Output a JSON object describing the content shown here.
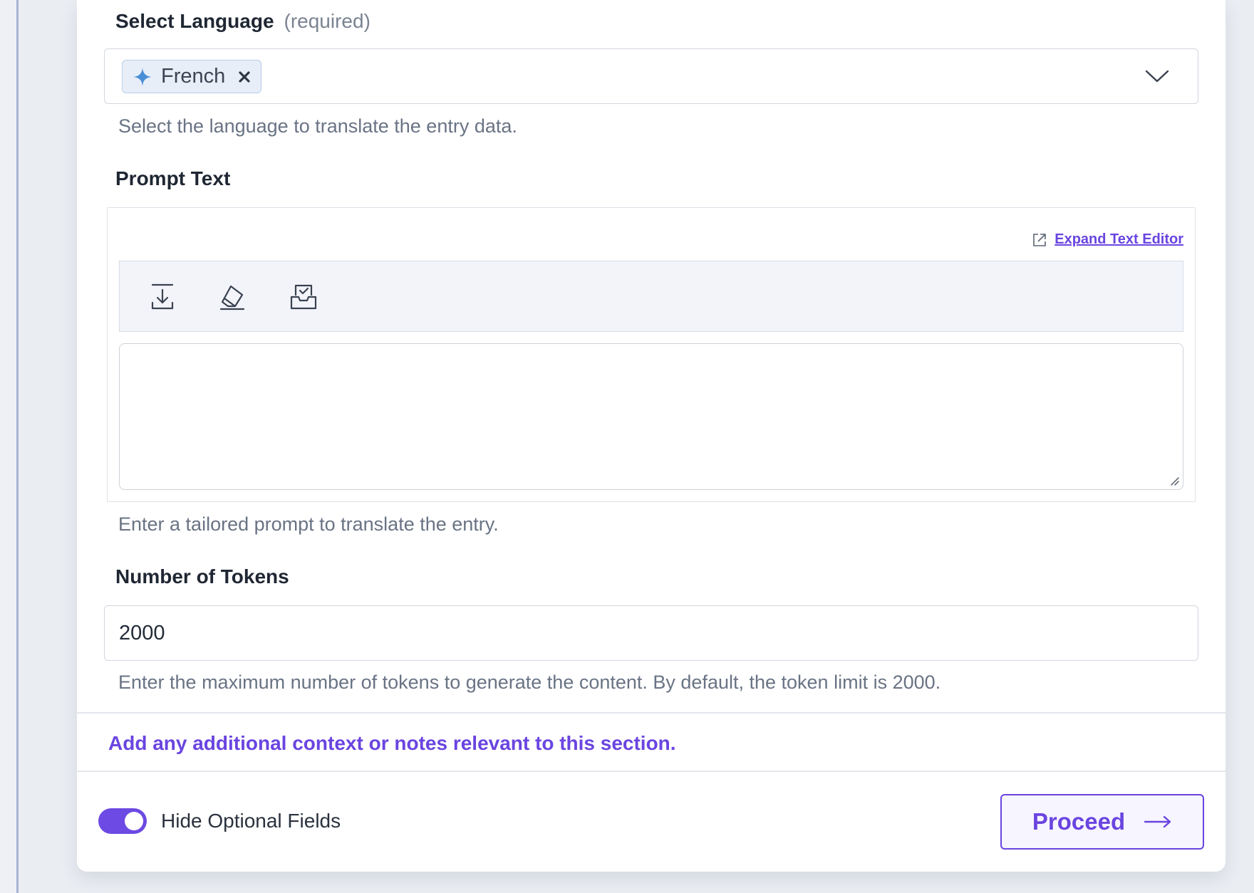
{
  "language_field": {
    "label": "Select Language",
    "required_note": "(required)",
    "selected_tag": "French",
    "help": "Select the language to translate the entry data."
  },
  "prompt_field": {
    "label": "Prompt Text",
    "expand_link": "Expand Text Editor",
    "toolbar_icons": [
      "download-icon",
      "eraser-icon",
      "inbox-check-icon"
    ],
    "value": "",
    "help": "Enter a tailored prompt to translate the entry."
  },
  "tokens_field": {
    "label": "Number of Tokens",
    "value": "2000",
    "help": "Enter the maximum number of tokens to generate the content. By default, the token limit is 2000."
  },
  "context_note": "Add any additional context or notes relevant to this section.",
  "footer": {
    "toggle_label": "Hide Optional Fields",
    "toggle_on": true,
    "proceed_label": "Proceed"
  },
  "colors": {
    "accent": "#6a45e0",
    "tag_bg": "#e8eef8",
    "sparkle": "#4a8fd6",
    "help_text": "#697384"
  }
}
